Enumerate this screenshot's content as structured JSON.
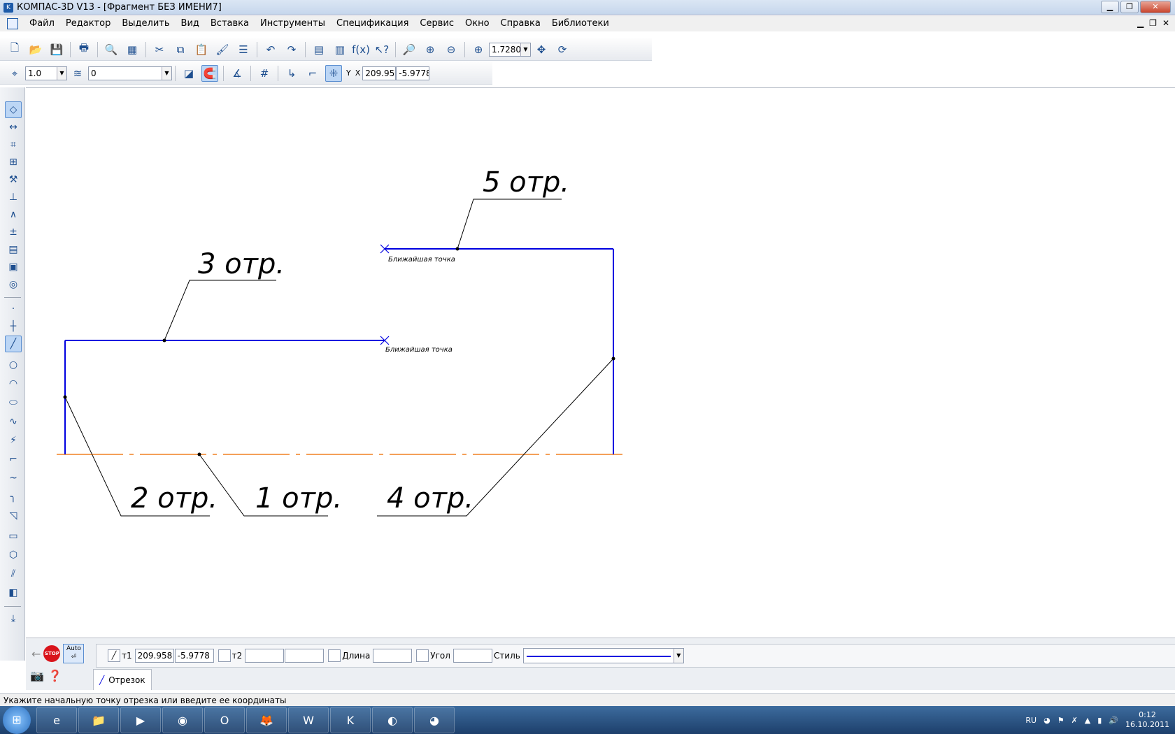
{
  "window": {
    "title": "КОМПАС-3D V13 - [Фрагмент БЕЗ ИМЕНИ7]"
  },
  "menu": {
    "items": [
      "Файл",
      "Редактор",
      "Выделить",
      "Вид",
      "Вставка",
      "Инструменты",
      "Спецификация",
      "Сервис",
      "Окно",
      "Справка",
      "Библиотеки"
    ]
  },
  "toolbar": {
    "zoom_value": "1.7280"
  },
  "current_toolbar": {
    "step_value": "1.0",
    "layer_value": "0",
    "coord_y_label": "Y",
    "coord_x_label": "X",
    "cursor_x": "209.958",
    "cursor_y": "-5.9778"
  },
  "drawing": {
    "labels": [
      "5 отр.",
      "3 отр.",
      "2 отр.",
      "1 отр.",
      "4 отр."
    ],
    "snap_hints": [
      "Ближайшая точка",
      "Ближайшая точка"
    ],
    "colors": {
      "segment": "#0000e0",
      "axis": "#f08020",
      "leader": "#000000"
    }
  },
  "property_panel": {
    "auto_label": "Auto",
    "stop_label": "STOP",
    "t1_label": "т1",
    "t1_x": "209.958",
    "t1_y": "-5.9778",
    "t2_label": "т2",
    "t2_x": "",
    "t2_y": "",
    "length_label": "Длина",
    "length_value": "",
    "angle_label": "Угол",
    "angle_value": "",
    "style_label": "Стиль",
    "tab_label": "Отрезок"
  },
  "status": {
    "text": "Укажите начальную точку отрезка или введите ее координаты"
  },
  "taskbar": {
    "lang": "RU",
    "time": "0:12",
    "date": "16.10.2011"
  }
}
